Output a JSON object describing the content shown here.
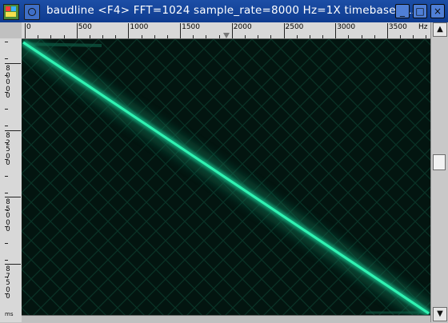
{
  "window": {
    "title": "baudline  <F4> FFT=1024 sample_rate=8000 Hz=1X timebase=1X",
    "buttons": {
      "minimize": "_",
      "maximize": "□",
      "close": "×"
    }
  },
  "top_ruler": {
    "labels": [
      "0",
      "500",
      "1000",
      "1500",
      "2000",
      "2500",
      "3000",
      "3500"
    ],
    "unit": "Hz"
  },
  "left_axis": {
    "labels": [
      "80000",
      "82500",
      "85000",
      "87500"
    ],
    "unit": "ms"
  },
  "spectrogram": {
    "background_color": "#031510",
    "signal_color": "#2ff2b2",
    "grid_color": "#0e4a38"
  },
  "scrollbar": {
    "up": "▲",
    "down": "▼"
  }
}
